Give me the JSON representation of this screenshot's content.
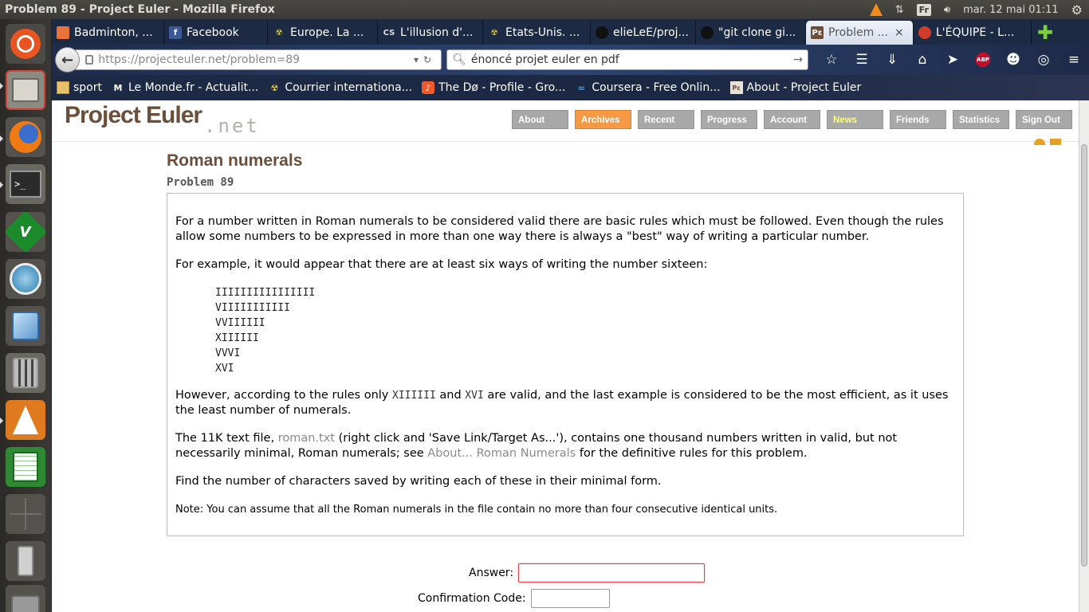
{
  "window": {
    "title": "Problem 89 - Project Euler - Mozilla Firefox"
  },
  "panel": {
    "keyboard_layout": "Fr",
    "clock": "mar. 12 mai 01:11",
    "icons": [
      "vlc-icon",
      "network-icon",
      "keyboard-icon",
      "volume-icon",
      "settings-icon"
    ]
  },
  "launcher": {
    "items": [
      "dash-home",
      "files",
      "firefox",
      "terminal",
      "vim",
      "network-manager",
      "virtualbox",
      "calculator",
      "vlc",
      "spreadsheet",
      "workspace-switcher",
      "usb-drive",
      "trash"
    ]
  },
  "tabs": [
    {
      "label": "Badminton, ...",
      "icon": "badminton-icon",
      "color": "#e8733a"
    },
    {
      "label": "Facebook",
      "icon": "facebook-icon",
      "color": "#3b5998"
    },
    {
      "label": "Europe. La ...",
      "icon": "courrier-icon",
      "color": "#f3d11a"
    },
    {
      "label": "L'illusion d'...",
      "icon": "cs-icon",
      "color": "#777777"
    },
    {
      "label": "Etats-Unis. ...",
      "icon": "courrier-icon",
      "color": "#f3d11a"
    },
    {
      "label": "elieLeE/proj...",
      "icon": "github-icon",
      "color": "#222222"
    },
    {
      "label": "\"git clone gi...",
      "icon": "github-icon",
      "color": "#222222"
    },
    {
      "label": "Problem ...",
      "icon": "project-euler-icon",
      "color": "#6b4f3a",
      "active": true
    },
    {
      "label": "L'ÉQUIPE - L...",
      "icon": "lequipe-icon",
      "color": "#d03b2a"
    }
  ],
  "navbar": {
    "url_host": "https://projecteuler.net",
    "url_path": "/problem=89",
    "search_value": "énoncé projet euler en pdf",
    "abp_label": "ABP"
  },
  "bookmarks": [
    {
      "label": "sport",
      "icon": "folder-icon"
    },
    {
      "label": "Le Monde.fr - Actualit...",
      "icon": "lemonde-icon"
    },
    {
      "label": "Courrier internationa...",
      "icon": "courrier-icon"
    },
    {
      "label": "The Dø - Profile - Gro...",
      "icon": "grooveshark-icon"
    },
    {
      "label": "Coursera - Free Onlin...",
      "icon": "coursera-icon"
    },
    {
      "label": "About - Project Euler",
      "icon": "project-euler-icon"
    }
  ],
  "site": {
    "logo_main": "Project Euler",
    "logo_suffix": ".net",
    "nav": [
      "About",
      "Archives",
      "Recent",
      "Progress",
      "Account",
      "News",
      "Friends",
      "Statistics",
      "Sign Out"
    ],
    "nav_selected": "Archives"
  },
  "problem": {
    "title": "Roman numerals",
    "number": "Problem 89",
    "p1": "For a number written in Roman numerals to be considered valid there are basic rules which must be followed. Even though the rules allow some numbers to be expressed in more than one way there is always a \"best\" way of writing a particular number.",
    "p2": "For example, it would appear that there are at least six ways of writing the number sixteen:",
    "numerals": [
      "IIIIIIIIIIIIIIII",
      "VIIIIIIIIIII",
      "VVIIIIII",
      "XIIIIII",
      "VVVI",
      "XVI"
    ],
    "p3_a": "However, according to the rules only ",
    "p3_code1": "XIIIIII",
    "p3_b": " and ",
    "p3_code2": "XVI",
    "p3_c": " are valid, and the last example is considered to be the most efficient, as it uses the least number of numerals.",
    "p4_a": "The 11K text file, ",
    "p4_link1": "roman.txt",
    "p4_b": " (right click and 'Save Link/Target As...'), contains one thousand numbers written in valid, but not necessarily minimal, Roman numerals; see ",
    "p4_link2": "About... Roman Numerals",
    "p4_c": " for the definitive rules for this problem.",
    "p5": "Find the number of characters saved by writing each of these in their minimal form.",
    "note": "Note: You can assume that all the Roman numerals in the file contain no more than four consecutive identical units."
  },
  "form": {
    "answer_label": "Answer:",
    "answer_value": "",
    "confirm_label": "Confirmation Code:",
    "confirm_value": ""
  }
}
